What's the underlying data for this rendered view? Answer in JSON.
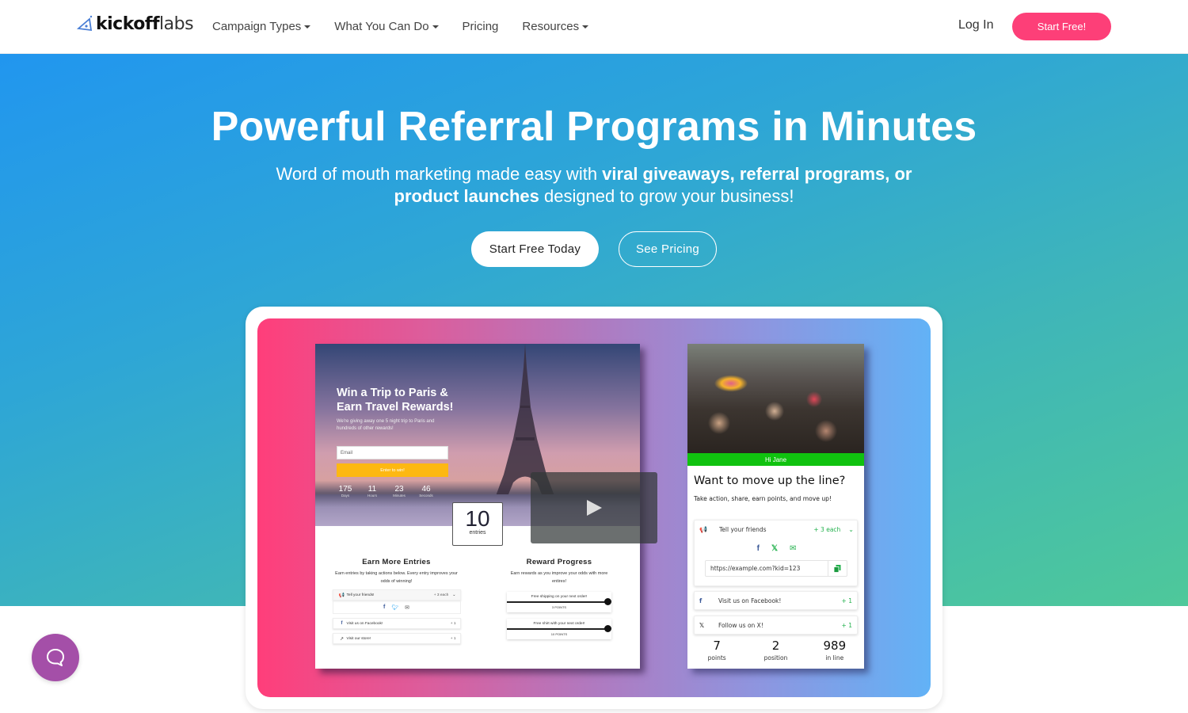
{
  "navbar": {
    "logo": {
      "bold": "kickoff",
      "light": "labs",
      "icon": "rocket-flask-icon"
    },
    "links": [
      {
        "label": "Campaign Types",
        "dropdown": true
      },
      {
        "label": "What You Can Do",
        "dropdown": true
      },
      {
        "label": "Pricing",
        "dropdown": false
      },
      {
        "label": "Resources",
        "dropdown": true
      }
    ],
    "login_label": "Log In",
    "start_label": "Start Free!",
    "accent_color": "#fd3f78"
  },
  "hero": {
    "title": "Powerful Referral Programs in Minutes",
    "subtitle": {
      "part1": "Word of mouth marketing made easy with ",
      "bold1": "viral giveaways, referral programs, or product launches",
      "part2": " designed to grow your business!"
    },
    "primary_button": "Start Free Today",
    "secondary_button": "See Pricing"
  },
  "showcase": {
    "giveaway": {
      "title": "Win a Trip to Paris & Earn Travel Rewards!",
      "description": "We're giving away one 5 night trip to Paris and hundreds of other rewards!",
      "email_placeholder": "Email",
      "enter_button": "Enter to win!",
      "countdown": [
        {
          "value": "175",
          "unit": "Days"
        },
        {
          "value": "11",
          "unit": "Hours"
        },
        {
          "value": "23",
          "unit": "Minutes"
        },
        {
          "value": "46",
          "unit": "Seconds"
        }
      ],
      "entries": {
        "value": "10",
        "label": "entries"
      },
      "earn": {
        "title": "Earn More Entries",
        "description": "Earn entries by taking actions below. Every entry improves your odds of winning!",
        "actions": [
          {
            "icon": "megaphone-icon",
            "label": "Tell your friends!",
            "points": "+ 3 each"
          },
          {
            "icon": "facebook-icon",
            "label": "Visit us on Facebook!",
            "points": "+ 1"
          },
          {
            "icon": "external-link-icon",
            "label": "Visit our store!",
            "points": "+ 1"
          }
        ]
      },
      "rewards": {
        "title": "Reward Progress",
        "description": "Earn rewards as you improve your odds with more entires!",
        "items": [
          {
            "label": "Free shipping on your next order!",
            "points": "3 POINTS",
            "progress": 1.0
          },
          {
            "label": "Free shirt with your next order!",
            "points": "10 POINTS",
            "progress": 1.0
          }
        ]
      }
    },
    "waitlist": {
      "greeting": "Hi Jane",
      "title": "Want to move up the line?",
      "description": "Take action, share, earn points, and move up!",
      "share_card": {
        "label": "Tell your friends",
        "points": "+ 3 each",
        "url": "https://example.com?kid=123"
      },
      "actions": [
        {
          "icon": "facebook-icon",
          "label": "Visit us on Facebook!",
          "points": "+ 1"
        },
        {
          "icon": "x-icon",
          "label": "Follow us on X!",
          "points": "+ 1"
        }
      ],
      "stats": [
        {
          "value": "7",
          "label": "points"
        },
        {
          "value": "2",
          "label": "position"
        },
        {
          "value": "989",
          "label": "in line"
        }
      ],
      "accent_color": "#10c20f"
    }
  }
}
